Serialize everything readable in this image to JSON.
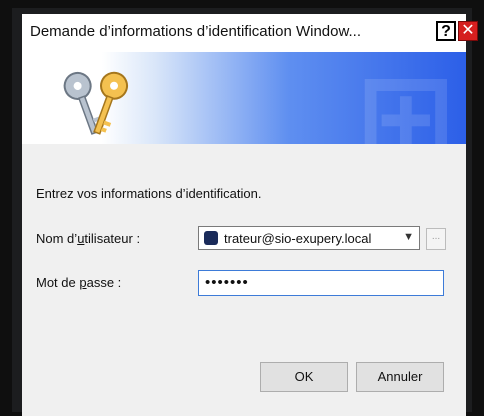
{
  "window": {
    "title": "Demande d’informations d’identification Window...",
    "help_glyph": "?",
    "close_glyph": "✕"
  },
  "banner": {
    "icon": "keys-icon"
  },
  "form": {
    "prompt": "Entrez vos informations d’identification.",
    "username_label_pre": "Nom d’",
    "username_label_u": "u",
    "username_label_post": "tilisateur :",
    "username_value": "trateur@sio-exupery.local",
    "more_button": "...",
    "password_label_pre": "Mot de ",
    "password_label_u": "p",
    "password_label_post": "asse :",
    "password_value": "•••••••"
  },
  "buttons": {
    "ok": "OK",
    "cancel": "Annuler"
  },
  "colors": {
    "accent": "#3d7bd8",
    "close": "#d51f1f"
  }
}
